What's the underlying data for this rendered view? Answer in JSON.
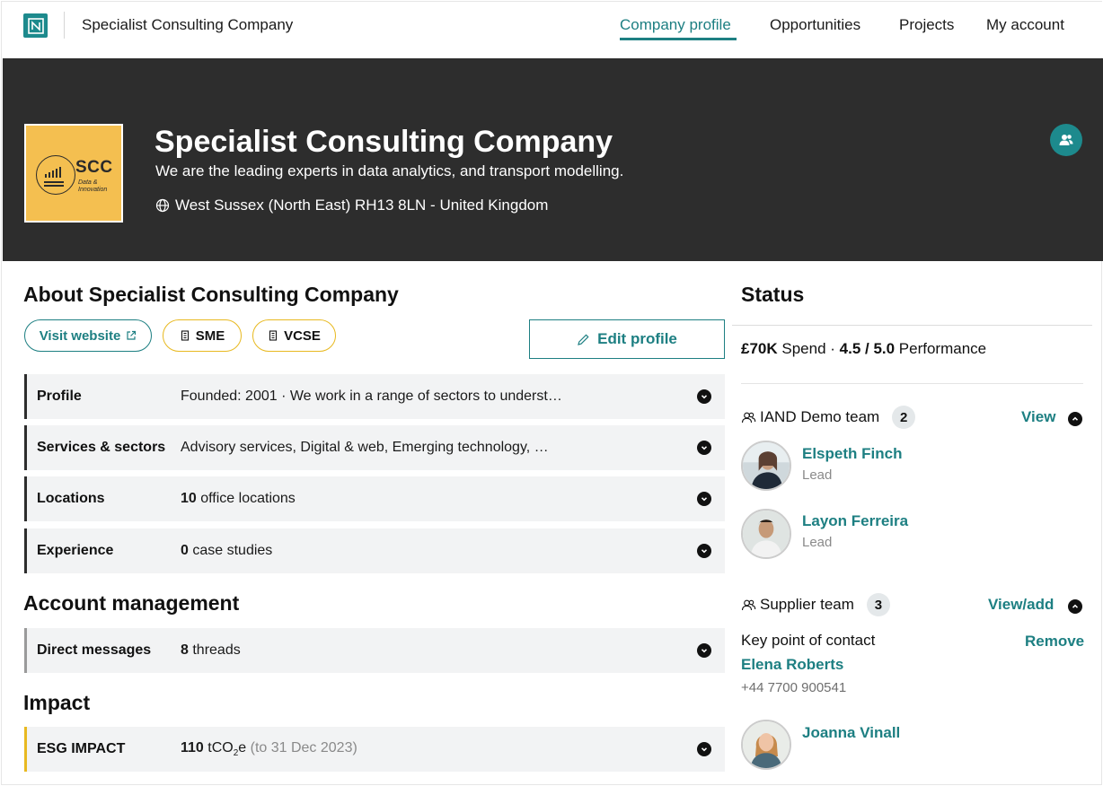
{
  "nav": {
    "app_title": "Specialist Consulting Company",
    "items": [
      "Company profile",
      "Opportunities",
      "Projects",
      "My account"
    ],
    "active": "Company profile"
  },
  "banner": {
    "logo_text": "SCC",
    "logo_sub_1": "Data &",
    "logo_sub_2": "Innovation",
    "title": "Specialist Consulting Company",
    "tagline": "We are the leading experts in data analytics, and transport modelling.",
    "location": "West Sussex (North East) RH13 8LN - United Kingdom"
  },
  "about": {
    "heading": "About Specialist Consulting Company",
    "visit_website": "Visit website",
    "badges": [
      "SME",
      "VCSE"
    ],
    "edit_profile": "Edit profile",
    "rows": [
      {
        "label": "Profile",
        "value": "Founded: 2001 · We work in a range of sectors to underst…"
      },
      {
        "label": "Services & sectors",
        "value": "Advisory services, Digital & web, Emerging technology, …"
      },
      {
        "label": "Locations",
        "count": "10",
        "value": " office locations"
      },
      {
        "label": "Experience",
        "count": "0",
        "value": " case studies"
      }
    ]
  },
  "account": {
    "heading": "Account management",
    "rows": [
      {
        "label": "Direct messages",
        "count": "8",
        "value": " threads"
      }
    ]
  },
  "impact": {
    "heading": "Impact",
    "label": "ESG IMPACT",
    "count": "110",
    "unit_pre": " tCO",
    "unit_sub": "2",
    "unit_post": "e",
    "note": " (to 31 Dec 2023)"
  },
  "status": {
    "heading": "Status",
    "spend": "£70K",
    "spend_label": " Spend · ",
    "performance": "4.5 / 5.0",
    "performance_label": " Performance"
  },
  "demo_team": {
    "name": "IAND Demo team",
    "count": "2",
    "action": "View",
    "members": [
      {
        "name": "Elspeth Finch",
        "role": "Lead"
      },
      {
        "name": "Layon Ferreira",
        "role": "Lead"
      }
    ]
  },
  "supplier_team": {
    "name": "Supplier team",
    "count": "3",
    "action": "View/add",
    "key_contact_label": "Key point of contact",
    "remove": "Remove",
    "key_contact_name": "Elena Roberts",
    "key_contact_phone": "+44 7700 900541",
    "other_member": "Joanna Vinall"
  },
  "colors": {
    "teal": "#1d7f82",
    "banner": "#2d2d2d",
    "logo_yellow": "#f4bf50",
    "badge_border": "#e8b920"
  }
}
